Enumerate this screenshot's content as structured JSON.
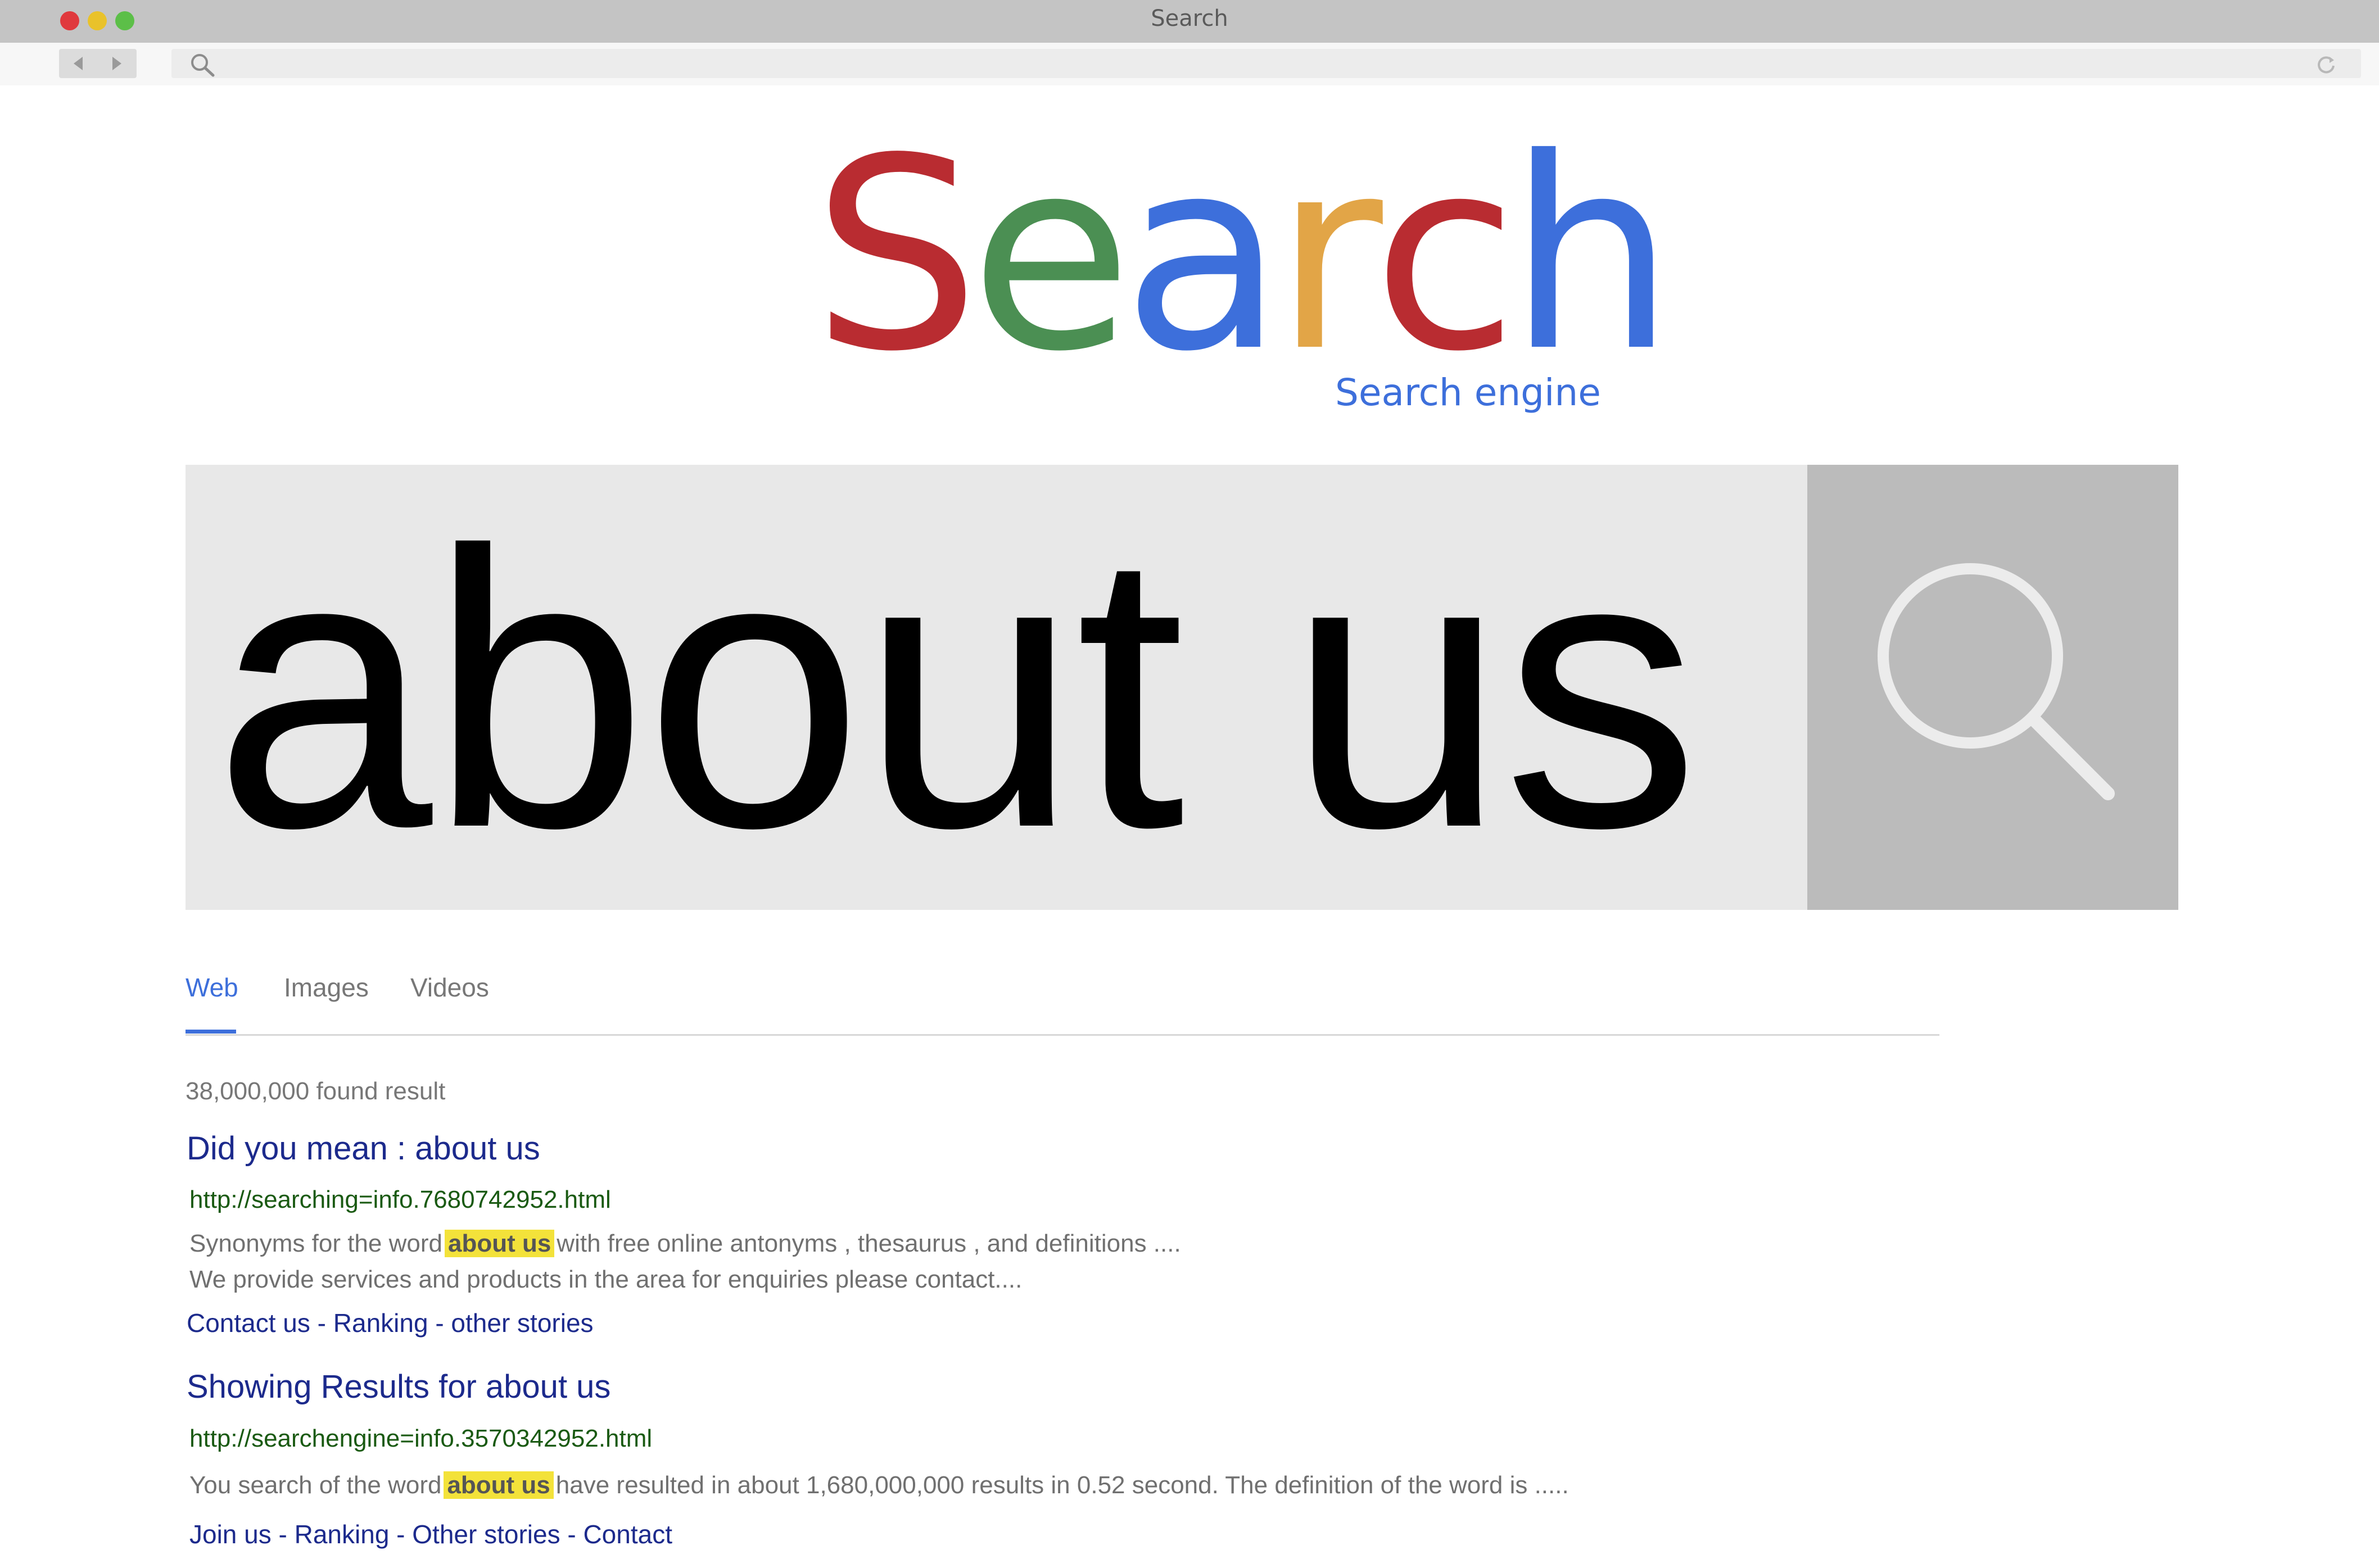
{
  "window": {
    "title": "Search"
  },
  "toolbar": {
    "back_icon": "chevron-left-icon",
    "forward_icon": "chevron-right-icon",
    "search_icon": "search-icon",
    "reload_icon": "reload-icon"
  },
  "logo": {
    "letters": [
      {
        "char": "S",
        "color": "#b92c31"
      },
      {
        "char": "e",
        "color": "#4b8f53"
      },
      {
        "char": "a",
        "color": "#3d6fdb"
      },
      {
        "char": "r",
        "color": "#e2a547"
      },
      {
        "char": "c",
        "color": "#b92c31"
      },
      {
        "char": "h",
        "color": "#3d6fdb"
      }
    ],
    "tagline": "Search engine"
  },
  "search": {
    "query": "about us",
    "button_icon": "search-icon"
  },
  "tabs": [
    {
      "label": "Web",
      "active": true
    },
    {
      "label": "Images",
      "active": false
    },
    {
      "label": "Videos",
      "active": false
    }
  ],
  "results": {
    "count_text": "38,000,000 found result",
    "items": [
      {
        "title": "Did you mean : about us",
        "url": "http://searching=info.7680742952.html",
        "snippet_before": "Synonyms for the word",
        "snippet_highlight": "about us",
        "snippet_after": "with free online antonyms , thesaurus , and definitions ....",
        "snippet_line2": "We provide services and products in the area for enquiries please contact....",
        "links": "Contact us - Ranking - other stories"
      },
      {
        "title": "Showing Results for  about us",
        "url": "http://searchengine=info.3570342952.html",
        "snippet_before": "You search of the word",
        "snippet_highlight": "about us",
        "snippet_after": "have resulted in about 1,680,000,000 results in 0.52 second. The definition of the word is .....",
        "links": "Join us - Ranking - Other stories - Contact"
      }
    ]
  },
  "colors": {
    "accent": "#3d6fdb",
    "link": "#1c2a8c",
    "url": "#1a5a12",
    "highlight": "#f3e23a"
  }
}
